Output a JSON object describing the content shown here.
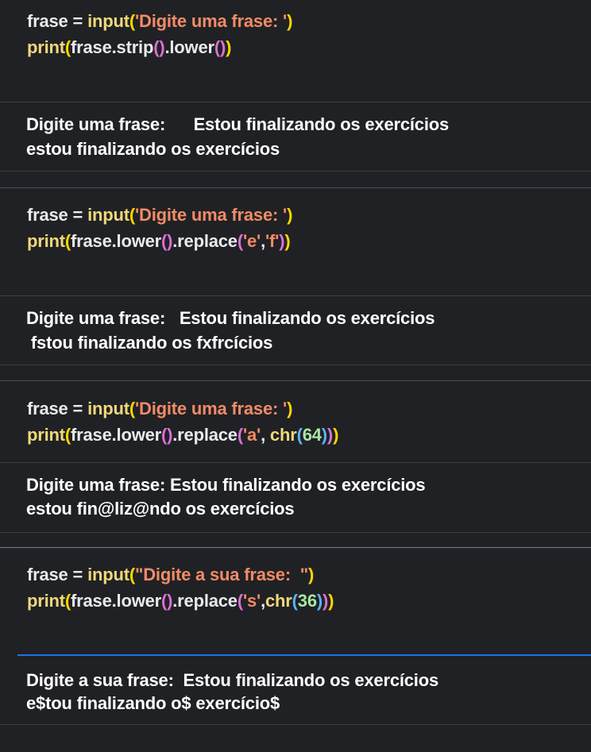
{
  "cells": [
    {
      "code": [
        [
          [
            "frase",
            "var"
          ],
          [
            " = ",
            "op"
          ],
          [
            "input",
            "fn"
          ],
          [
            "(",
            "paren1"
          ],
          [
            "'Digite uma frase: '",
            "str"
          ],
          [
            ")",
            "paren1"
          ]
        ],
        [
          [
            "print",
            "fn"
          ],
          [
            "(",
            "paren1"
          ],
          [
            "frase.strip",
            "var"
          ],
          [
            "()",
            "paren2"
          ],
          [
            ".lower",
            "var"
          ],
          [
            "()",
            "paren2"
          ],
          [
            ")",
            "paren1"
          ]
        ]
      ],
      "output": [
        "Digite uma frase:      Estou finalizando os exercícios",
        "estou finalizando os exercícios"
      ]
    },
    {
      "code": [
        [
          [
            "frase",
            "var"
          ],
          [
            " = ",
            "op"
          ],
          [
            "input",
            "fn"
          ],
          [
            "(",
            "paren1"
          ],
          [
            "'Digite uma frase: '",
            "str"
          ],
          [
            ")",
            "paren1"
          ]
        ],
        [
          [
            "print",
            "fn"
          ],
          [
            "(",
            "paren1"
          ],
          [
            "frase.lower",
            "var"
          ],
          [
            "()",
            "paren2"
          ],
          [
            ".replace",
            "var"
          ],
          [
            "(",
            "paren2"
          ],
          [
            "'e'",
            "str"
          ],
          [
            ",",
            "op"
          ],
          [
            "'f'",
            "str"
          ],
          [
            ")",
            "paren2"
          ],
          [
            ")",
            "paren1"
          ]
        ]
      ],
      "output": [
        "Digite uma frase:   Estou finalizando os exercícios",
        " fstou finalizando os fxfrcícios"
      ]
    },
    {
      "code": [
        [
          [
            "frase",
            "var"
          ],
          [
            " = ",
            "op"
          ],
          [
            "input",
            "fn"
          ],
          [
            "(",
            "paren1"
          ],
          [
            "'Digite uma frase: '",
            "str"
          ],
          [
            ")",
            "paren1"
          ]
        ],
        [
          [
            "print",
            "fn"
          ],
          [
            "(",
            "paren1"
          ],
          [
            "frase.lower",
            "var"
          ],
          [
            "()",
            "paren2"
          ],
          [
            ".replace",
            "var"
          ],
          [
            "(",
            "paren2"
          ],
          [
            "'a'",
            "str"
          ],
          [
            ", ",
            "op"
          ],
          [
            "chr",
            "fn"
          ],
          [
            "(",
            "paren3"
          ],
          [
            "64",
            "num"
          ],
          [
            ")",
            "paren3"
          ],
          [
            ")",
            "paren2"
          ],
          [
            ")",
            "paren1"
          ]
        ]
      ],
      "output": [
        "Digite uma frase: Estou finalizando os exercícios",
        "estou fin@liz@ndo os exercícios"
      ]
    },
    {
      "code": [
        [
          [
            "frase",
            "var"
          ],
          [
            " = ",
            "op"
          ],
          [
            "input",
            "fn"
          ],
          [
            "(",
            "paren1"
          ],
          [
            "\"Digite a sua frase:  \"",
            "str"
          ],
          [
            ")",
            "paren1"
          ]
        ],
        [
          [
            "print",
            "fn"
          ],
          [
            "(",
            "paren1"
          ],
          [
            "frase.lower",
            "var"
          ],
          [
            "()",
            "paren2"
          ],
          [
            ".replace",
            "var"
          ],
          [
            "(",
            "paren2"
          ],
          [
            "'s'",
            "str"
          ],
          [
            ",",
            "op"
          ],
          [
            "chr",
            "fn"
          ],
          [
            "(",
            "paren3"
          ],
          [
            "36",
            "num"
          ],
          [
            ")",
            "paren3"
          ],
          [
            ")",
            "paren2"
          ],
          [
            ")",
            "paren1"
          ]
        ]
      ],
      "output": [
        "Digite a sua frase:  Estou finalizando os exercícios",
        "e$tou finalizando o$ exercício$"
      ]
    }
  ],
  "colors": {
    "background": "#202124",
    "string": "#f28b66",
    "function": "#f0d87a",
    "paren_level1": "#ffd700",
    "paren_level2": "#da70d6",
    "paren_level3": "#5cb3ff",
    "number": "#a8e6a3",
    "accent": "#1a73e8"
  }
}
